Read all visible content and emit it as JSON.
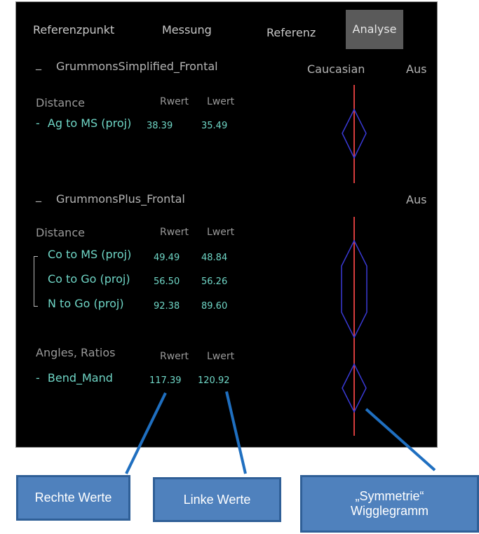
{
  "tabs": [
    "Referenzpunkt",
    "Messung",
    "Referenz",
    "Analyse"
  ],
  "columns": {
    "caucasian": "Caucasian",
    "aus_1": "Aus",
    "aus_2": "Aus"
  },
  "group1": {
    "marker": "_",
    "title": "GrummonsSimplified_Frontal",
    "section": "Distance",
    "rwert": "Rwert",
    "lwert": "Lwert",
    "rows": [
      {
        "prefix": "-",
        "label": "Ag to MS (proj)",
        "r": "38.39",
        "l": "35.49"
      }
    ]
  },
  "group2": {
    "marker": "_",
    "title": "GrummonsPlus_Frontal",
    "section": "Distance",
    "rwert": "Rwert",
    "lwert": "Lwert",
    "rows": [
      {
        "label": "Co to MS (proj)",
        "r": "49.49",
        "l": "48.84"
      },
      {
        "label": "Co to Go (proj)",
        "r": "56.50",
        "l": "56.26"
      },
      {
        "label": "N to Go (proj)",
        "r": "92.38",
        "l": "89.60"
      }
    ],
    "angles_section": "Angles, Ratios",
    "angles_rwert": "Rwert",
    "angles_lwert": "Lwert",
    "angle_rows": [
      {
        "prefix": "-",
        "label": "Bend_Mand",
        "r": "117.39",
        "l": "120.92"
      }
    ]
  },
  "callouts": {
    "right": "Rechte Werte",
    "left": "Linke Werte",
    "wiggle_line1": "„Symmetrie“",
    "wiggle_line2": "Wigglegramm"
  },
  "colors": {
    "axis": "#d63c3c",
    "wiggle": "#3a3ad6",
    "callout": "#4f81bd",
    "text_value": "#6fd6c6"
  }
}
